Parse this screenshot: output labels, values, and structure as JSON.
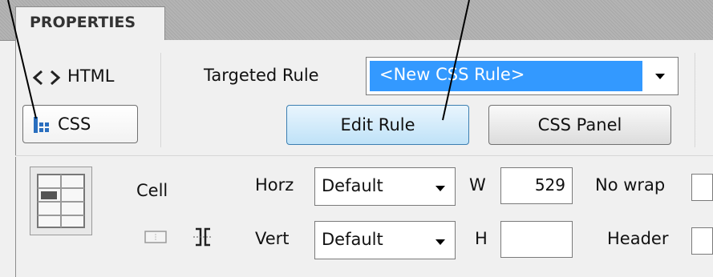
{
  "tabs": [
    {
      "label": "PROPERTIES"
    }
  ],
  "mode": {
    "html_label": "HTML",
    "css_label": "CSS"
  },
  "targeted_rule": {
    "label": "Targeted Rule",
    "value": "<New CSS Rule>"
  },
  "buttons": {
    "edit_rule": "Edit Rule",
    "css_panel": "CSS Panel"
  },
  "cell": {
    "label": "Cell",
    "horz_label": "Horz",
    "horz_value": "Default",
    "vert_label": "Vert",
    "vert_value": "Default",
    "w_label": "W",
    "w_value": "529",
    "h_label": "H",
    "h_value": "",
    "nowrap_label": "No wrap",
    "header_label": "Header"
  },
  "colors": {
    "selection": "#3399ff",
    "edit_rule_bg": "#c6e6fa"
  }
}
